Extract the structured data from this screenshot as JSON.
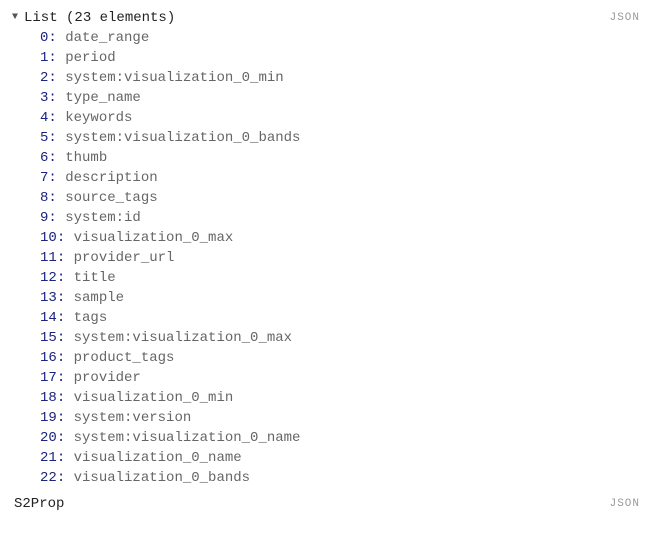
{
  "header": {
    "label": "List",
    "count_text": "(23 elements)",
    "json_button": "JSON"
  },
  "items": [
    {
      "index": "0",
      "value": "date_range"
    },
    {
      "index": "1",
      "value": "period"
    },
    {
      "index": "2",
      "value": "system:visualization_0_min"
    },
    {
      "index": "3",
      "value": "type_name"
    },
    {
      "index": "4",
      "value": "keywords"
    },
    {
      "index": "5",
      "value": "system:visualization_0_bands"
    },
    {
      "index": "6",
      "value": "thumb"
    },
    {
      "index": "7",
      "value": "description"
    },
    {
      "index": "8",
      "value": "source_tags"
    },
    {
      "index": "9",
      "value": "system:id"
    },
    {
      "index": "10",
      "value": "visualization_0_max"
    },
    {
      "index": "11",
      "value": "provider_url"
    },
    {
      "index": "12",
      "value": "title"
    },
    {
      "index": "13",
      "value": "sample"
    },
    {
      "index": "14",
      "value": "tags"
    },
    {
      "index": "15",
      "value": "system:visualization_0_max"
    },
    {
      "index": "16",
      "value": "product_tags"
    },
    {
      "index": "17",
      "value": "provider"
    },
    {
      "index": "18",
      "value": "visualization_0_min"
    },
    {
      "index": "19",
      "value": "system:version"
    },
    {
      "index": "20",
      "value": "system:visualization_0_name"
    },
    {
      "index": "21",
      "value": "visualization_0_name"
    },
    {
      "index": "22",
      "value": "visualization_0_bands"
    }
  ],
  "footer": {
    "label": "S2Prop",
    "json_button": "JSON"
  },
  "separator": ": "
}
